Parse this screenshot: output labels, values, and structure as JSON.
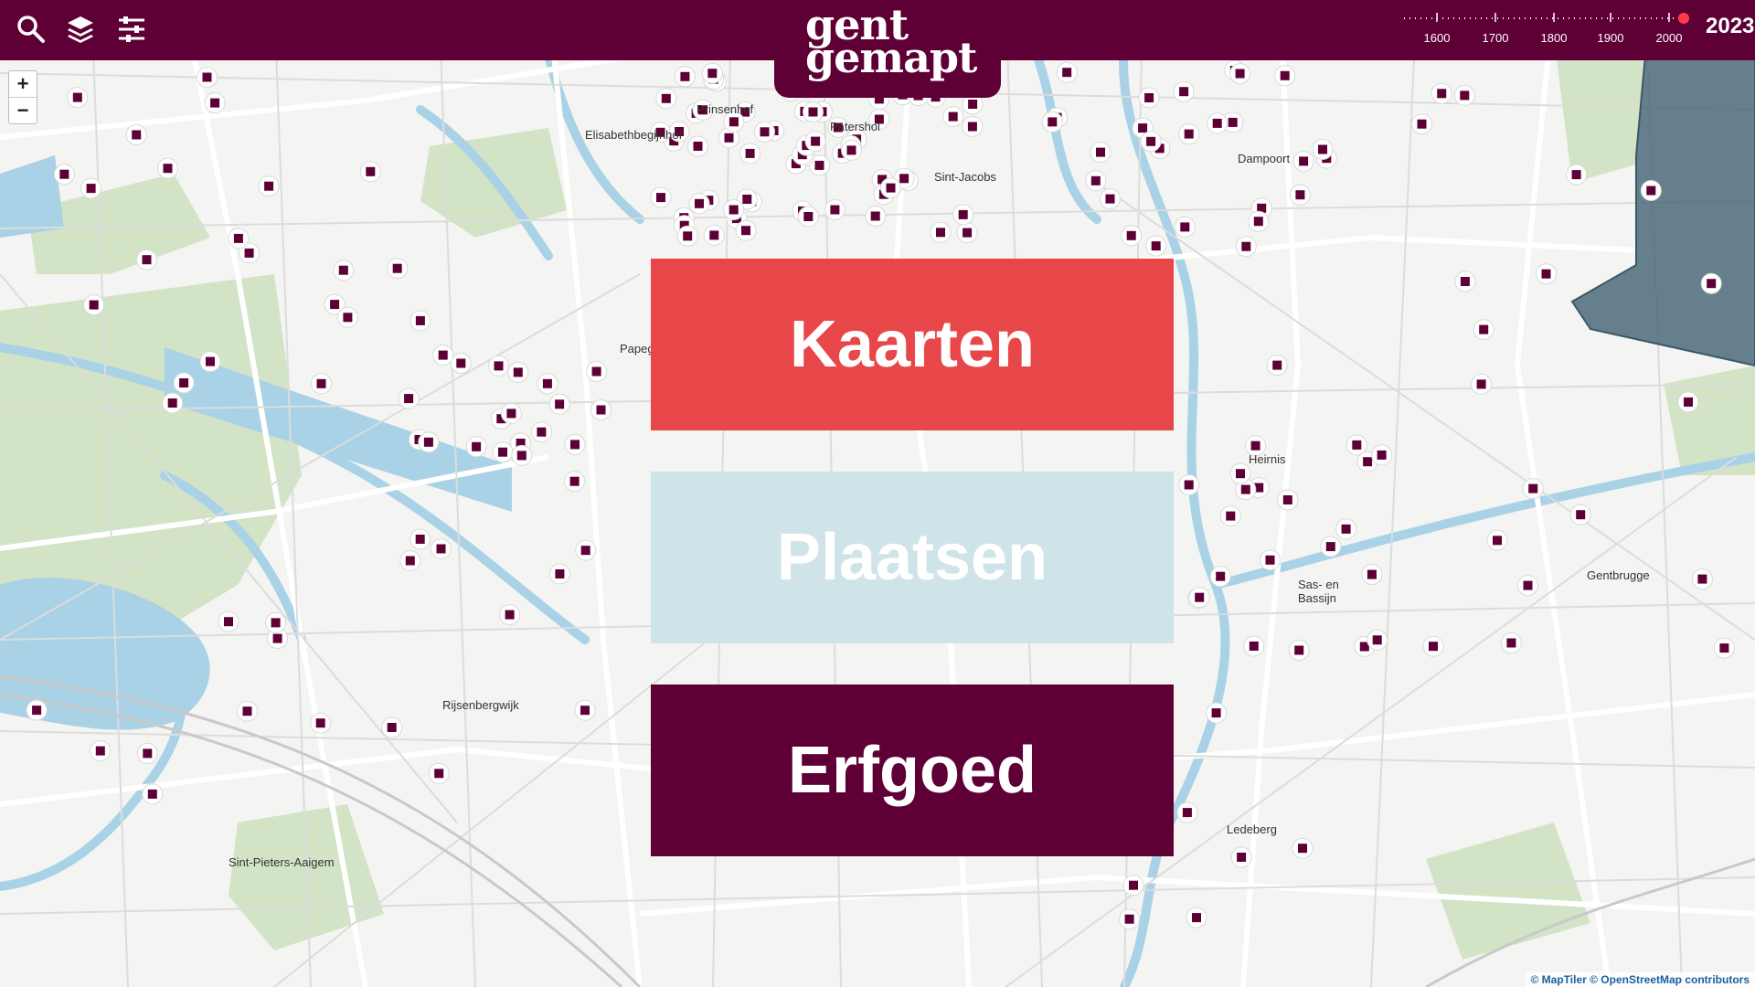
{
  "header": {
    "logo_line1": "gent",
    "logo_line2": "gemapt",
    "icons": [
      "search-icon",
      "layers-icon",
      "filter-icon"
    ],
    "timeline_labels": [
      "1600",
      "1700",
      "1800",
      "1900",
      "2000"
    ],
    "current_year": "2023"
  },
  "zoom": {
    "in": "+",
    "out": "−"
  },
  "categories": [
    {
      "label": "Kaarten",
      "color": "#e8474a",
      "text_color": "#ffffff"
    },
    {
      "label": "Plaatsen",
      "color": "#cfe4e9",
      "text_color": "#ffffff"
    },
    {
      "label": "Erfgoed",
      "color": "#5e0035",
      "text_color": "#ffffff"
    }
  ],
  "map_labels": [
    "Prinsenhof",
    "Elisabethbegijnhof",
    "Patershol",
    "Sint-Jacobs",
    "Dampoort",
    "Papegaai",
    "Heirnis",
    "Sas- en Bassijn",
    "Gentbrugge",
    "Rijsenbergwijk",
    "Sint-Pieters-Aaigem",
    "Ledeberg"
  ],
  "attribution": "© MapTiler © OpenStreetMap contributors",
  "colors": {
    "brand": "#5e0035",
    "water": "#a9d2e6",
    "park": "#cfe0c0"
  }
}
